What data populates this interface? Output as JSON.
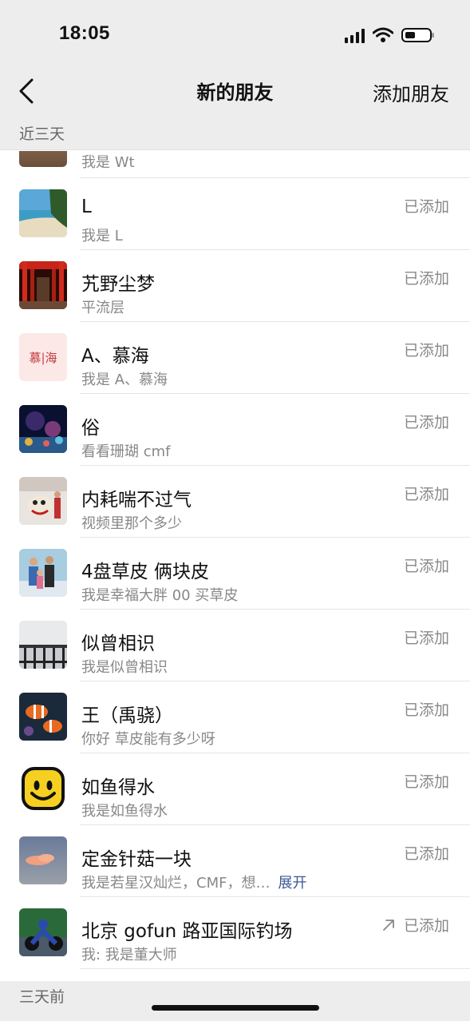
{
  "status_bar": {
    "time": "18:05"
  },
  "nav": {
    "title": "新的朋友",
    "action": "添加朋友"
  },
  "sections": {
    "recent": "近三天",
    "older": "三天前"
  },
  "first_partial": {
    "subtitle": "我是 Wt"
  },
  "rows": [
    {
      "name": "L",
      "subtitle": "我是 L",
      "status": "已添加",
      "avatar": "beach-photo"
    },
    {
      "name": "艽野尘梦",
      "subtitle": "平流层",
      "status": "已添加",
      "avatar": "red-torii-photo"
    },
    {
      "name": "A、慕海",
      "subtitle": "我是 A、慕海",
      "status": "已添加",
      "avatar": "text-logo",
      "avatar_text": "慕|海"
    },
    {
      "name": "俗",
      "subtitle": "看看珊瑚 cmf",
      "status": "已添加",
      "avatar": "coral-photo"
    },
    {
      "name": "内耗喘不过气",
      "subtitle": "视频里那个多少",
      "status": "已添加",
      "avatar": "lion-dance-photo"
    },
    {
      "name": "4盘草皮 俩块皮",
      "subtitle": "我是幸福大胖 00 买草皮",
      "status": "已添加",
      "avatar": "family-photo"
    },
    {
      "name": "似曾相识",
      "subtitle": "我是似曾相识",
      "status": "已添加",
      "avatar": "railing-photo"
    },
    {
      "name": "王（禹骁）",
      "subtitle": "你好  草皮能有多少呀",
      "status": "已添加",
      "avatar": "clownfish-photo"
    },
    {
      "name": "如鱼得水",
      "subtitle": "我是如鱼得水",
      "status": "已添加",
      "avatar": "smiley-face"
    },
    {
      "name": "定金针菇一块",
      "subtitle": "我是若星汉灿烂，CMF，想…",
      "expand": "展开",
      "status": "已添加",
      "avatar": "sunset-cloud-photo"
    },
    {
      "name": "北京 gofun 路亚国际钓场",
      "subtitle": "我: 我是董大师",
      "status": "已添加",
      "status_icon": "arrow-up-right-icon",
      "avatar": "motorcycle-photo"
    }
  ]
}
